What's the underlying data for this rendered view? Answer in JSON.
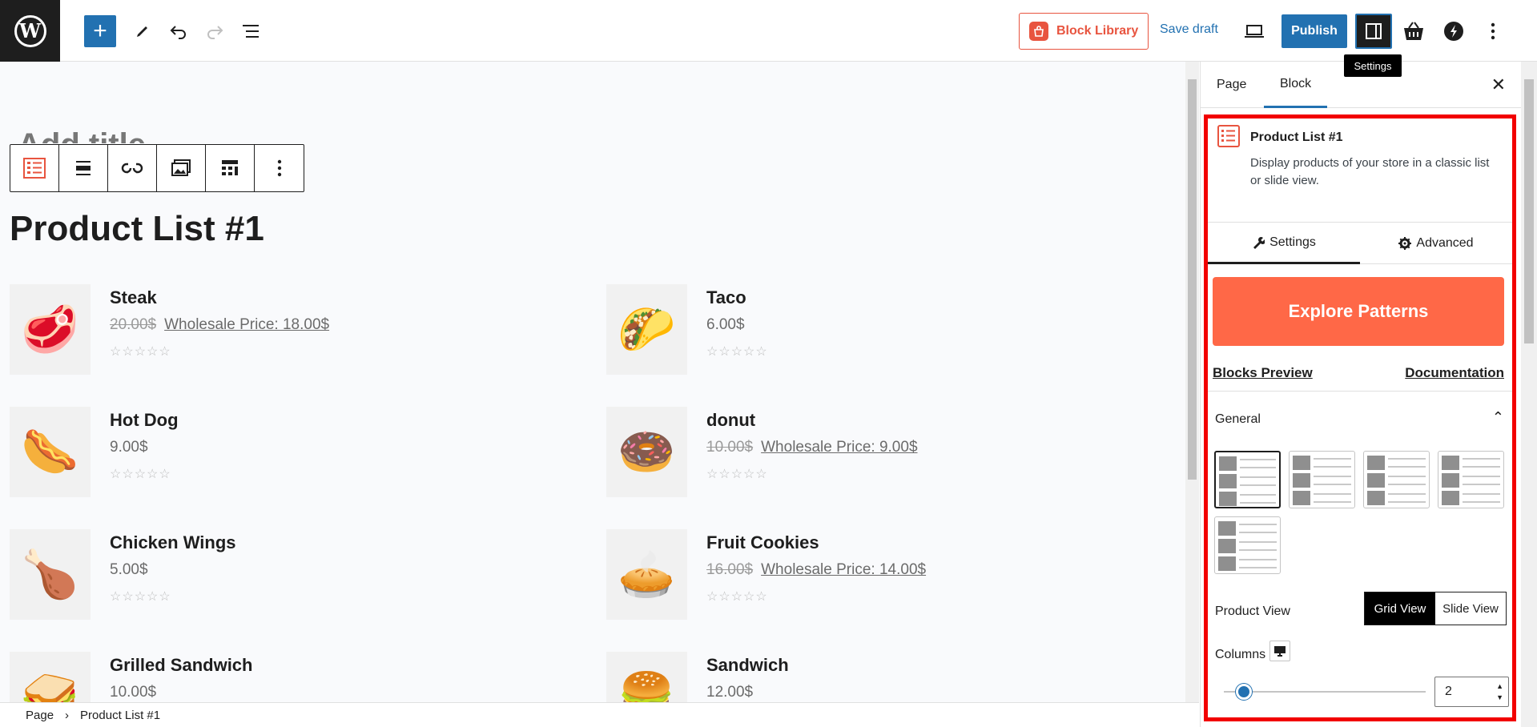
{
  "topbar": {
    "block_library_label": "Block Library",
    "save_draft_label": "Save draft",
    "publish_label": "Publish",
    "settings_tooltip": "Settings"
  },
  "canvas": {
    "page_title": "Product List #1",
    "ghost_title": "Add title"
  },
  "products": [
    {
      "name": "Steak",
      "price": "20.00$",
      "wholesale": "Wholesale Price: 18.00$",
      "has_wholesale": true,
      "icon": "steak-image"
    },
    {
      "name": "Taco",
      "price": "6.00$",
      "wholesale": "",
      "has_wholesale": false,
      "icon": "taco-image"
    },
    {
      "name": "Hot Dog",
      "price": "9.00$",
      "wholesale": "",
      "has_wholesale": false,
      "icon": "hotdog-image"
    },
    {
      "name": "donut",
      "price": "10.00$",
      "wholesale": "Wholesale Price: 9.00$",
      "has_wholesale": true,
      "icon": "donut-image"
    },
    {
      "name": "Chicken Wings",
      "price": "5.00$",
      "wholesale": "",
      "has_wholesale": false,
      "icon": "chicken-wings-image"
    },
    {
      "name": "Fruit Cookies",
      "price": "16.00$",
      "wholesale": "Wholesale Price: 14.00$",
      "has_wholesale": true,
      "icon": "fruit-cookies-image"
    },
    {
      "name": "Grilled Sandwich",
      "price": "10.00$",
      "wholesale": "",
      "has_wholesale": false,
      "icon": "grilled-sandwich-image"
    },
    {
      "name": "Sandwich",
      "price": "12.00$",
      "wholesale": "",
      "has_wholesale": false,
      "icon": "sandwich-image"
    }
  ],
  "statusbar": {
    "crumb_page": "Page",
    "crumb_block": "Product List #1"
  },
  "sidebar": {
    "tab_page": "Page",
    "tab_block": "Block",
    "block_name": "Product List #1",
    "block_description": "Display products of your store in a classic list or slide view.",
    "settings_tab": "Settings",
    "advanced_tab": "Advanced",
    "explore_label": "Explore Patterns",
    "blocks_preview_label": "Blocks Preview",
    "documentation_label": "Documentation",
    "general_label": "General",
    "product_view_label": "Product View",
    "grid_view_label": "Grid View",
    "slide_view_label": "Slide View",
    "columns_label": "Columns",
    "columns_value": "2",
    "columns_slider_fraction": 0.1
  },
  "colors": {
    "accent": "#2271b1",
    "brand": "#ff6847",
    "highlight_frame": "#f20000"
  }
}
